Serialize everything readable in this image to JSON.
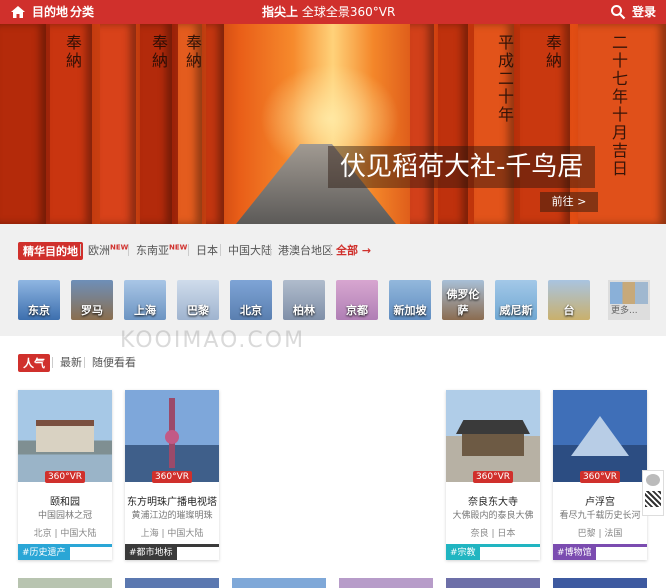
{
  "topbar": {
    "destination": "目的地",
    "category": "分类",
    "brand_bold": "指尖上",
    "brand_rest": "全球全景360°VR",
    "login": "登录"
  },
  "hero": {
    "caption": "伏见稻荷大社-千鸟居",
    "goto": "前往 >",
    "kanji": [
      "奉納",
      "奉納",
      "奉納",
      "平成二十年",
      "奉納",
      "二十七年十月吉日"
    ]
  },
  "dest_tabs": {
    "featured": "精华目的地",
    "europe": "欧洲",
    "europe_badge": "NEW",
    "sea": "东南亚",
    "sea_badge": "NEW",
    "japan": "日本",
    "china": "中国大陆",
    "hkmo": "港澳台地区",
    "all": "全部 →"
  },
  "cities": [
    {
      "name": "东京",
      "color": "#3d6fae"
    },
    {
      "name": "罗马",
      "color": "#8a6e4e"
    },
    {
      "name": "上海",
      "color": "#6c94c2"
    },
    {
      "name": "巴黎",
      "color": "#9fb4cf"
    },
    {
      "name": "北京",
      "color": "#5a7fb0"
    },
    {
      "name": "柏林",
      "color": "#7f8fa8"
    },
    {
      "name": "京都",
      "color": "#b07fb5"
    },
    {
      "name": "新加坡",
      "color": "#5f8cc0"
    },
    {
      "name": "佛罗伦萨",
      "color": "#8b6c50"
    },
    {
      "name": "威尼斯",
      "color": "#6fa7d2"
    },
    {
      "name": "台",
      "color": "#c9b06c"
    }
  ],
  "more_label": "更多...",
  "watermark": "KOOIMAO.COM",
  "sort": {
    "popular": "人气",
    "latest": "最新",
    "random": "随便看看"
  },
  "cards": [
    {
      "title": "颐和园",
      "subtitle": "中国园林之冠",
      "location": "北京 | 中国大陆",
      "tag": "#历史遗产",
      "tag_color": "#2aa6d6",
      "vr": "360°VR",
      "img_color": "#8fb8d8"
    },
    {
      "title": "东方明珠广播电视塔",
      "subtitle": "黄浦江边的璀璨明珠",
      "location": "上海 | 中国大陆",
      "tag": "#都市地标",
      "tag_color": "#3a3a3a",
      "vr": "360°VR",
      "img_color": "#5f8bc6"
    },
    {
      "title": "奈良东大寺",
      "subtitle": "大佛殿内的泰良大佛",
      "location": "奈良 | 日本",
      "tag": "#宗教",
      "tag_color": "#21b5c1",
      "vr": "360°VR",
      "img_color": "#8cb4da"
    },
    {
      "title": "卢浮宫",
      "subtitle": "看尽九千载历史长河",
      "location": "巴黎 | 法国",
      "tag": "#博物馆",
      "tag_color": "#7b4cb0",
      "vr": "360°VR",
      "img_color": "#4d7fc4"
    }
  ]
}
